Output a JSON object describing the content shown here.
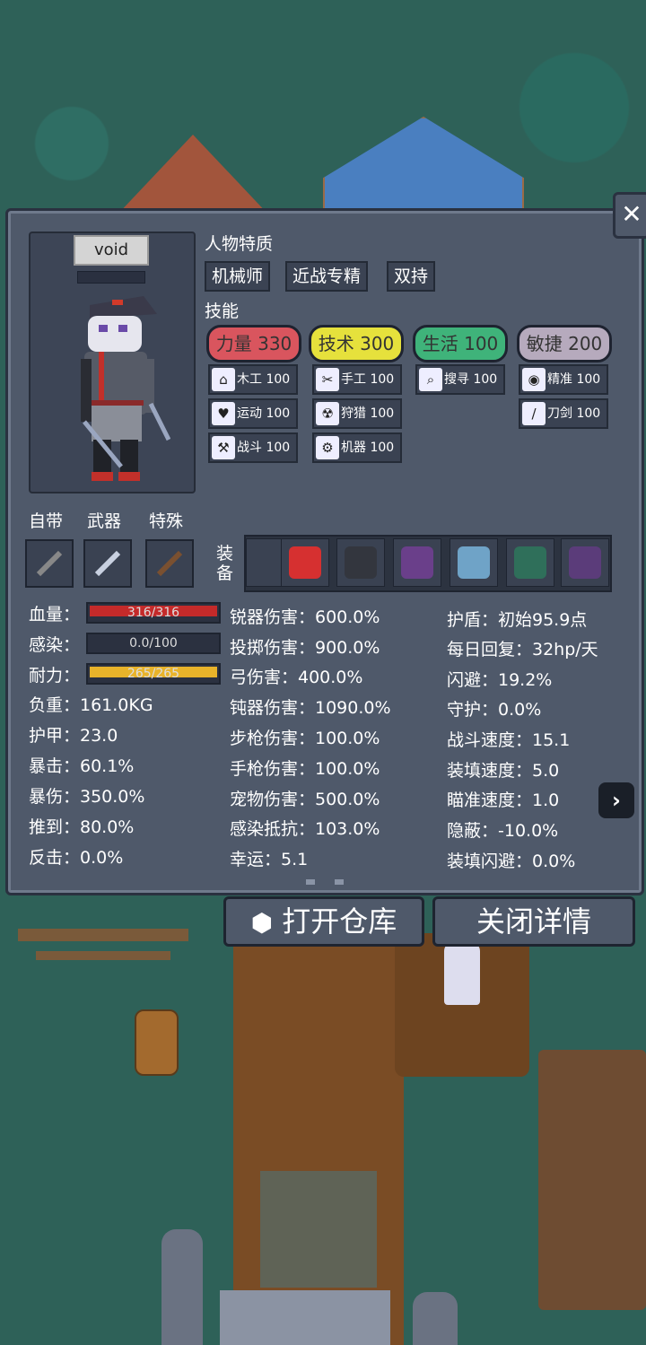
{
  "character": {
    "name": "void"
  },
  "traits": {
    "title": "人物特质",
    "items": [
      "机械师",
      "近战专精",
      "双持"
    ]
  },
  "skills": {
    "title": "技能",
    "attributes": [
      {
        "label": "力量 330",
        "color": "#d9555e"
      },
      {
        "label": "技术 300",
        "color": "#e6e13c"
      },
      {
        "label": "生活 100",
        "color": "#3fb37a"
      },
      {
        "label": "敏捷 200",
        "color": "#b6aabd"
      }
    ],
    "list": [
      {
        "icon": "house-icon",
        "glyph": "⌂",
        "label": "木工 100"
      },
      {
        "icon": "scissors-icon",
        "glyph": "✂",
        "label": "手工 100"
      },
      {
        "icon": "magnifier-icon",
        "glyph": "⌕",
        "label": "搜寻 100"
      },
      {
        "icon": "eye-icon",
        "glyph": "◉",
        "label": "精准 100"
      },
      {
        "icon": "heart-icon",
        "glyph": "♥",
        "label": "运动 100"
      },
      {
        "icon": "radiation-icon",
        "glyph": "☢",
        "label": "狩猎 100"
      },
      {
        "icon": "sword-icon",
        "glyph": "/",
        "label": "刀剑 100"
      },
      {
        "icon": "axe-icon",
        "glyph": "⚒",
        "label": "战斗 100"
      },
      {
        "icon": "gear-icon",
        "glyph": "⚙",
        "label": "机器 100"
      }
    ]
  },
  "equipment": {
    "carry_label": "自带",
    "weapon_label": "武器",
    "special_label": "特殊",
    "equip_label_1": "装",
    "equip_label_2": "备",
    "items": [
      {
        "icon": "empty-slot",
        "color": "#2c3340"
      },
      {
        "icon": "medkit-icon",
        "color": "#d63030"
      },
      {
        "icon": "flashlight-icon",
        "color": "#33363e"
      },
      {
        "icon": "armor-vest-icon",
        "color": "#6a3f8a"
      },
      {
        "icon": "shirt-icon",
        "color": "#6fa3c7"
      },
      {
        "icon": "backpack-icon",
        "color": "#2f6f5a"
      },
      {
        "icon": "boots-icon",
        "color": "#5b3c7a"
      }
    ]
  },
  "vitals": {
    "hp_label": "血量：",
    "hp_text": "316/316",
    "hp_fraction": 1.0,
    "hp_color": "#c42a2a",
    "infect_label": "感染：",
    "infect_text": "0.0/100",
    "infect_fraction": 0.0,
    "stamina_label": "耐力：",
    "stamina_text": "265/265",
    "stamina_fraction": 1.0,
    "stamina_color": "#e8b32a"
  },
  "stats_left": [
    "负重：161.0KG",
    "护甲：23.0",
    "暴击：60.1%",
    "暴伤：350.0%",
    "推到：80.0%",
    "反击：0.0%"
  ],
  "stats_mid": [
    "锐器伤害：600.0%",
    "投掷伤害：900.0%",
    "弓伤害：400.0%",
    "钝器伤害：1090.0%",
    "步枪伤害：100.0%",
    "手枪伤害：100.0%",
    "宠物伤害：500.0%",
    "感染抵抗：103.0%",
    "幸运：5.1"
  ],
  "stats_right": [
    "护盾：初始95.9点",
    "每日回复：32hp/天",
    "闪避：19.2%",
    "守护：0.0%",
    "战斗速度：15.1",
    "装填速度：5.0",
    "瞄准速度：1.0",
    "隐蔽：-10.0%",
    "装填闪避：0.0%"
  ],
  "buttons": {
    "open_storage": "打开仓库",
    "close_details": "关闭详情",
    "close": "✕",
    "next": "›"
  }
}
